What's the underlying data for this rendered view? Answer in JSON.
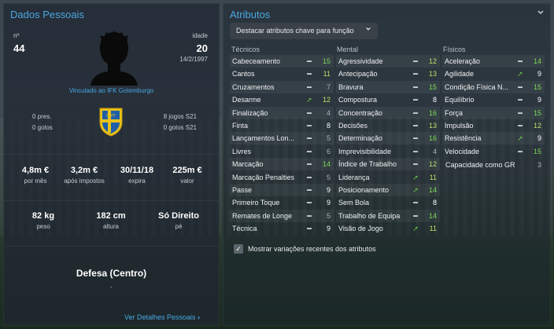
{
  "personal": {
    "title": "Dados Pessoais",
    "number_label": "nº",
    "number_value": "44",
    "age_label": "idade",
    "age_value": "20",
    "birth_date": "14/2/1997",
    "club_link": "Vinculado ao IFK Gotemburgo",
    "left_stats": [
      "0 pres.",
      "0 golos"
    ],
    "right_stats": [
      "8 jogos S21",
      "0 golos S21"
    ],
    "finance": [
      {
        "value": "4,8m €",
        "label": "por mês"
      },
      {
        "value": "3,2m €",
        "label": "após impostos"
      },
      {
        "value": "30/11/18",
        "label": "expira"
      },
      {
        "value": "225m €",
        "label": "valor"
      }
    ],
    "physical": [
      {
        "value": "82 kg",
        "label": "peso"
      },
      {
        "value": "182 cm",
        "label": "altura"
      },
      {
        "value": "Só Direito",
        "label": "pé"
      }
    ],
    "position": "Defesa (Centro)",
    "position_sub": "-",
    "details_link": "Ver Detalhes Pessoais"
  },
  "attributes": {
    "title": "Atributos",
    "dropdown_label": "Destacar atributos chave para função",
    "tecnicos": {
      "label": "Técnicos",
      "items": [
        {
          "name": "Cabeceamento",
          "ind": "dash",
          "val": "15"
        },
        {
          "name": "Cantos",
          "ind": "dash",
          "val": "11"
        },
        {
          "name": "Cruzamentos",
          "ind": "dash",
          "val": "7"
        },
        {
          "name": "Desarme",
          "ind": "up",
          "val": "12"
        },
        {
          "name": "Finalização",
          "ind": "dash",
          "val": "4"
        },
        {
          "name": "Finta",
          "ind": "dash",
          "val": "8"
        },
        {
          "name": "Lançamentos Lon...",
          "ind": "dash",
          "val": "5"
        },
        {
          "name": "Livres",
          "ind": "dash",
          "val": "6"
        },
        {
          "name": "Marcação",
          "ind": "dash",
          "val": "14"
        },
        {
          "name": "Marcação Penalties",
          "ind": "dash",
          "val": "5"
        },
        {
          "name": "Passe",
          "ind": "dash",
          "val": "9"
        },
        {
          "name": "Primeiro Toque",
          "ind": "dash",
          "val": "9"
        },
        {
          "name": "Remates de Longe",
          "ind": "dash",
          "val": "5"
        },
        {
          "name": "Técnica",
          "ind": "dash",
          "val": "9"
        }
      ]
    },
    "mental": {
      "label": "Mental",
      "items": [
        {
          "name": "Agressividade",
          "ind": "dash",
          "val": "12"
        },
        {
          "name": "Antecipação",
          "ind": "dash",
          "val": "13"
        },
        {
          "name": "Bravura",
          "ind": "dash",
          "val": "15"
        },
        {
          "name": "Compostura",
          "ind": "dash",
          "val": "8"
        },
        {
          "name": "Concentração",
          "ind": "dash",
          "val": "16"
        },
        {
          "name": "Decisões",
          "ind": "dash",
          "val": "13"
        },
        {
          "name": "Determinação",
          "ind": "dash",
          "val": "16"
        },
        {
          "name": "Imprevisibilidade",
          "ind": "dash",
          "val": "4"
        },
        {
          "name": "Índice de Trabalho",
          "ind": "dash",
          "val": "12"
        },
        {
          "name": "Liderança",
          "ind": "up",
          "val": "11"
        },
        {
          "name": "Posicionamento",
          "ind": "up",
          "val": "14"
        },
        {
          "name": "Sem Bola",
          "ind": "dash",
          "val": "8"
        },
        {
          "name": "Trabalho de Equipa",
          "ind": "dash",
          "val": "14"
        },
        {
          "name": "Visão de Jogo",
          "ind": "up",
          "val": "11"
        }
      ]
    },
    "fisicos": {
      "label": "Físicos",
      "items": [
        {
          "name": "Aceleração",
          "ind": "dash",
          "val": "14"
        },
        {
          "name": "Agilidade",
          "ind": "up",
          "val": "9"
        },
        {
          "name": "Condição Física N...",
          "ind": "dash",
          "val": "15"
        },
        {
          "name": "Equilíbrio",
          "ind": "dash",
          "val": "9"
        },
        {
          "name": "Força",
          "ind": "dash",
          "val": "15"
        },
        {
          "name": "Impulsão",
          "ind": "dash",
          "val": "12"
        },
        {
          "name": "Resistência",
          "ind": "up",
          "val": "9"
        },
        {
          "name": "Velocidade",
          "ind": "dash",
          "val": "15"
        }
      ],
      "extra_name": "Capacidade como GR",
      "extra_val": "3"
    },
    "checkbox_label": "Mostrar variações recentes dos atributos"
  }
}
